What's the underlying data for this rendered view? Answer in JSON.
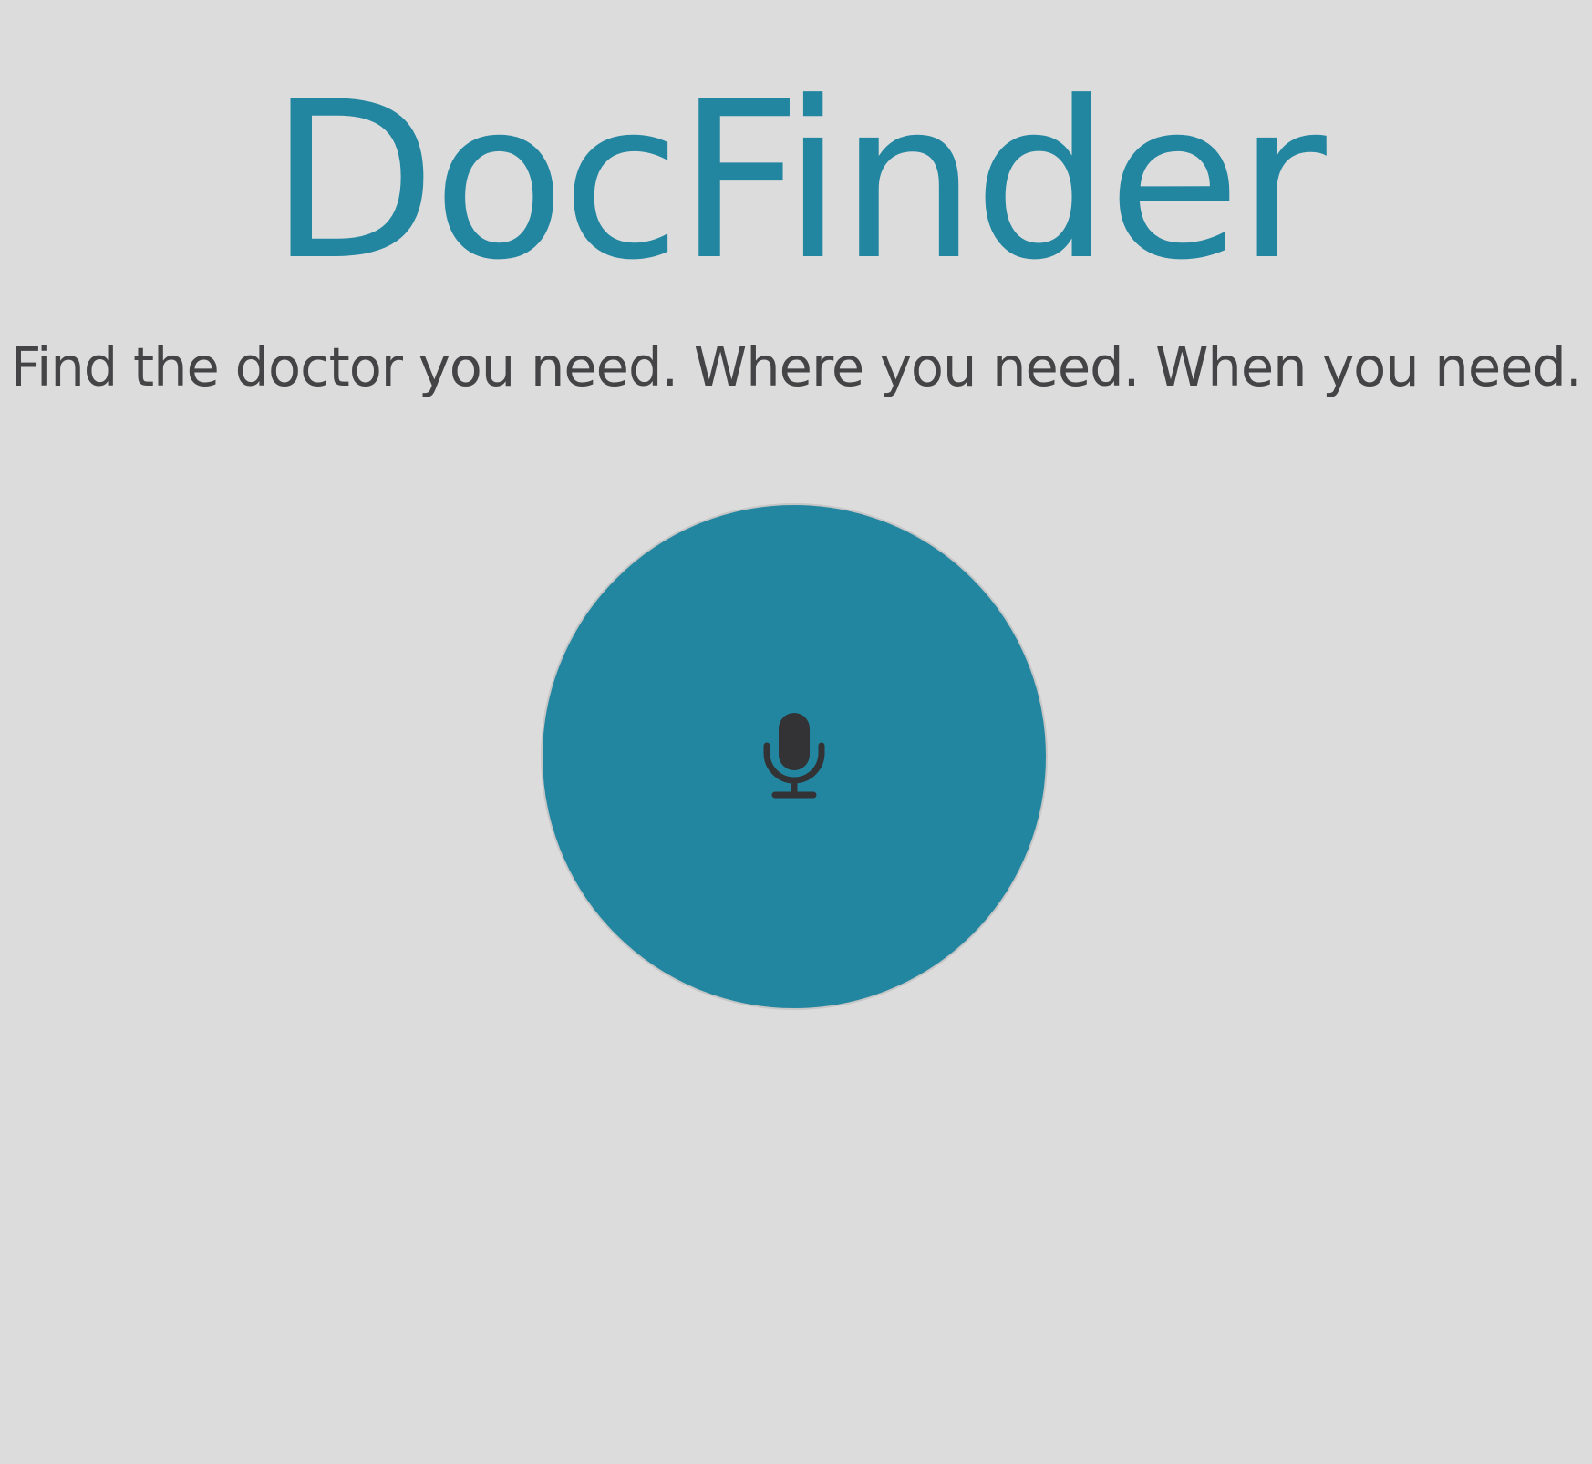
{
  "app": {
    "title": "DocFinder",
    "tagline": "Find the doctor you need. Where you need. When you need."
  },
  "voice_button": {
    "icon": "microphone-icon",
    "color": "#2386a1",
    "icon_color": "#333335"
  },
  "colors": {
    "background": "#dcdcdc",
    "brand": "#2386a1",
    "text": "#444446"
  }
}
